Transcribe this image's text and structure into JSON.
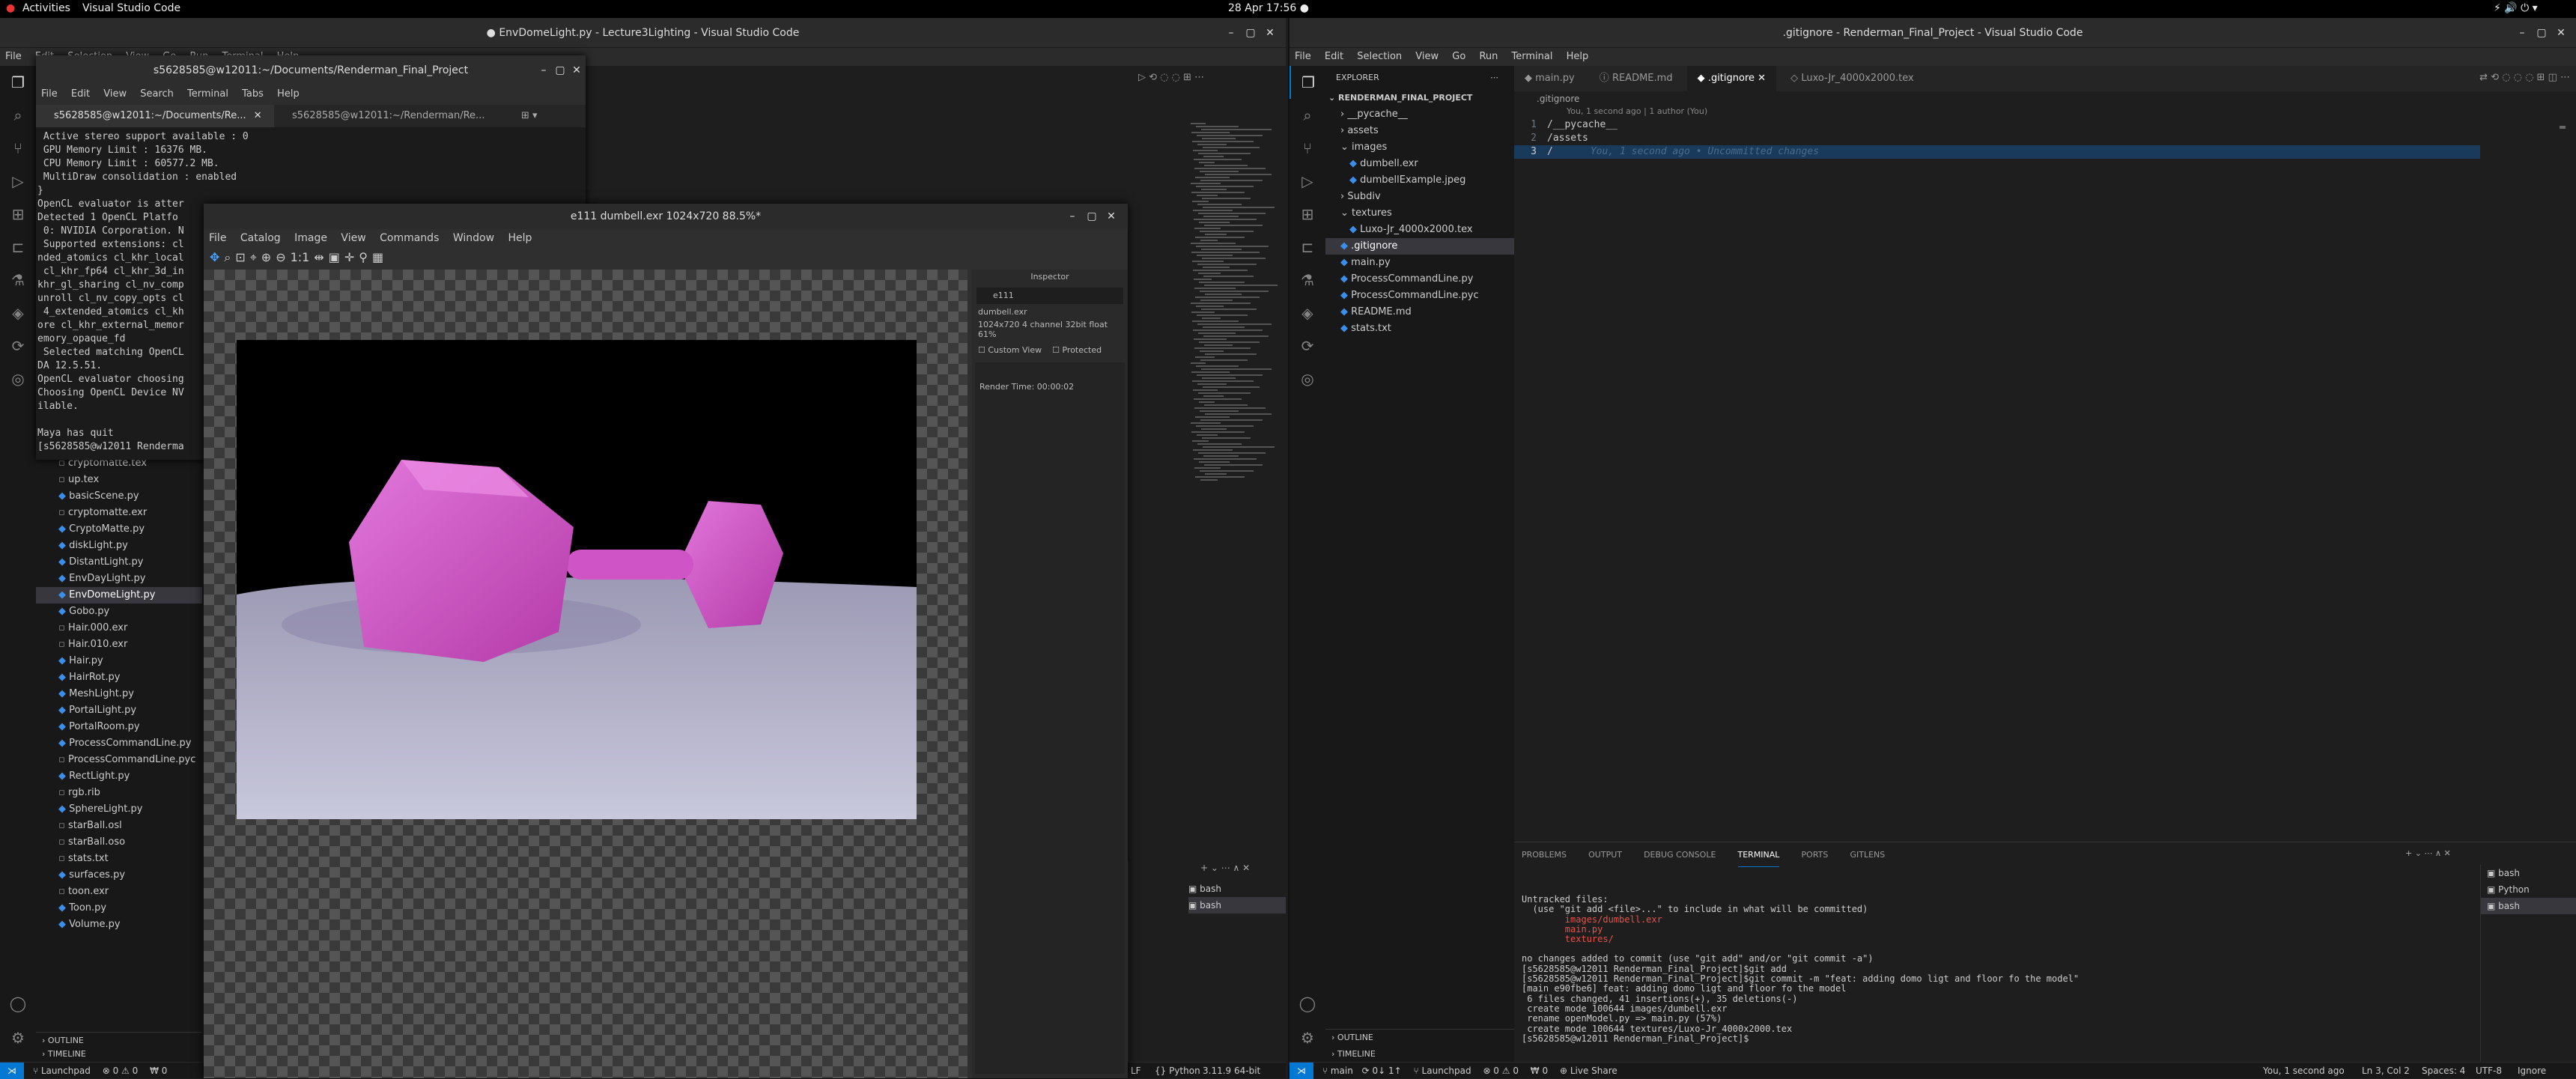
{
  "system": {
    "activities": "Activities",
    "app": "Visual Studio Code",
    "clock": "28 Apr  17:56 ●"
  },
  "left_vscode": {
    "title": "● EnvDomeLight.py - Lecture3Lighting - Visual Studio Code",
    "menu": [
      "File",
      "Edit",
      "Selection",
      "View",
      "Go",
      "Run",
      "Terminal",
      "Help"
    ],
    "files": [
      "cryptomatte.tex",
      "up.tex",
      "basicScene.py",
      "cryptomatte.exr",
      "CryptoMatte.py",
      "diskLight.py",
      "DistantLight.py",
      "EnvDayLight.py",
      "EnvDomeLight.py",
      "Gobo.py",
      "Hair.000.exr",
      "Hair.010.exr",
      "Hair.py",
      "HairRot.py",
      "MeshLight.py",
      "PortalLight.py",
      "PortalRoom.py",
      "ProcessCommandLine.py",
      "ProcessCommandLine.pyc",
      "RectLight.py",
      "rgb.rib",
      "SphereLight.py",
      "starBall.osl",
      "starBall.oso",
      "stats.txt",
      "surfaces.py",
      "toon.exr",
      "Toon.py",
      "Volume.py"
    ],
    "outline": "OUTLINE",
    "timeline": "TIMELINE",
    "term_list": [
      "bash",
      "bash"
    ],
    "status": {
      "branch": "⑂ Launchpad",
      "errors": "⊗ 0 ⚠ 0",
      "w0": "₩ 0",
      "lf": "LF",
      "lang": "{} Python",
      "ver": "3.11.9 64-bit"
    }
  },
  "gnome_terminal": {
    "title": "s5628585@w12011:~/Documents/Renderman_Final_Project",
    "menu": [
      "File",
      "Edit",
      "View",
      "Search",
      "Terminal",
      "Tabs",
      "Help"
    ],
    "tabs": [
      "s5628585@w12011:~/Documents/Re...",
      "s5628585@w12011:~/Renderman/Re..."
    ],
    "lines": [
      " Active stereo support available : 0",
      " GPU Memory Limit : 16376 MB.",
      " CPU Memory Limit : 60577.2 MB.",
      " MultiDraw consolidation : enabled",
      "}",
      "OpenCL evaluator is atter",
      "Detected 1 OpenCL Platfo",
      " 0: NVIDIA Corporation. N",
      " Supported extensions: cl",
      "nded_atomics cl_khr_local",
      " cl_khr_fp64 cl_khr_3d_in",
      "khr_gl_sharing cl_nv_comp",
      "unroll cl_nv_copy_opts cl",
      " 4_extended_atomics cl_kh",
      "ore cl_khr_external_memor",
      "emory_opaque_fd",
      " Selected matching OpenCL",
      "DA 12.5.51.",
      "OpenCL evaluator choosing",
      "Choosing OpenCL Device NV",
      "ilable.",
      "",
      "Maya has quit",
      "[s5628585@w12011 Renderma"
    ]
  },
  "it_viewer": {
    "title": "e111 dumbell.exr 1024x720 88.5%*",
    "menu": [
      "File",
      "Catalog",
      "Image",
      "View",
      "Commands",
      "Window",
      "Help"
    ],
    "inspector": {
      "title": "Inspector",
      "name": "e111",
      "file": "dumbell.exr",
      "info": "1024x720 4 channel 32bit float 61%",
      "custom_view": "Custom View",
      "protected": "Protected",
      "render_time": "Render Time: 00:00:02"
    }
  },
  "right_vscode": {
    "title": ".gitignore - Renderman_Final_Project - Visual Studio Code",
    "menu": [
      "File",
      "Edit",
      "Selection",
      "View",
      "Go",
      "Run",
      "Terminal",
      "Help"
    ],
    "explorer_title": "EXPLORER",
    "project": "RENDERMAN_FINAL_PROJECT",
    "tree": [
      {
        "label": "__pycache__",
        "indent": 1,
        "type": "folder",
        "arrow": "›"
      },
      {
        "label": "assets",
        "indent": 1,
        "type": "folder",
        "arrow": "›"
      },
      {
        "label": "images",
        "indent": 1,
        "type": "folder",
        "arrow": "⌄"
      },
      {
        "label": "dumbell.exr",
        "indent": 2,
        "type": "file"
      },
      {
        "label": "dumbellExample.jpeg",
        "indent": 2,
        "type": "file"
      },
      {
        "label": "Subdiv",
        "indent": 1,
        "type": "folder",
        "arrow": "›"
      },
      {
        "label": "textures",
        "indent": 1,
        "type": "folder",
        "arrow": "⌄"
      },
      {
        "label": "Luxo-Jr_4000x2000.tex",
        "indent": 2,
        "type": "file"
      },
      {
        "label": ".gitignore",
        "indent": 1,
        "type": "file",
        "selected": true
      },
      {
        "label": "main.py",
        "indent": 1,
        "type": "file"
      },
      {
        "label": "ProcessCommandLine.py",
        "indent": 1,
        "type": "file"
      },
      {
        "label": "ProcessCommandLine.pyc",
        "indent": 1,
        "type": "file"
      },
      {
        "label": "README.md",
        "indent": 1,
        "type": "file"
      },
      {
        "label": "stats.txt",
        "indent": 1,
        "type": "file"
      }
    ],
    "tabs": [
      "main.py",
      "README.md",
      ".gitignore",
      "Luxo-Jr_4000x2000.tex"
    ],
    "breadcrumb": ".gitignore",
    "blame": "You, 1 second ago | 1 author (You)",
    "code": [
      "/__pycache__",
      "/assets",
      "/"
    ],
    "inline_blame": "You, 1 second ago • Uncommitted changes",
    "panel_tabs": [
      "PROBLEMS",
      "OUTPUT",
      "DEBUG CONSOLE",
      "TERMINAL",
      "PORTS",
      "GITLENS"
    ],
    "terminal_lines": [
      "Untracked files:",
      "  (use \"git add <file>...\" to include in what will be committed)",
      "        images/dumbell.exr",
      "        main.py",
      "        textures/",
      "",
      "no changes added to commit (use \"git add\" and/or \"git commit -a\")",
      "[s5628585@w12011 Renderman_Final_Project]$git add .",
      "[s5628585@w12011 Renderman_Final_Project]$git commit -m \"feat: adding domo ligt and floor fo the model\"",
      "[main e90fbe6] feat: adding domo ligt and floor fo the model",
      " 6 files changed, 41 insertions(+), 35 deletions(-)",
      " create mode 100644 images/dumbell.exr",
      " rename openModel.py => main.py (57%)",
      " create mode 100644 textures/Luxo-Jr_4000x2000.tex",
      "[s5628585@w12011 Renderman_Final_Project]$"
    ],
    "term_list": [
      "bash",
      "Python",
      "bash"
    ],
    "outline": "OUTLINE",
    "timeline": "TIMELINE",
    "status": {
      "branch": "⑂ main",
      "sync": "⟳ 0↓ 1↑",
      "launch": "⑂ Launchpad",
      "errors": "⊗ 0 ⚠ 0",
      "w0": "₩ 0",
      "live": "⊕ Live Share",
      "blame": "You, 1 second ago",
      "pos": "Ln 3, Col 2",
      "spaces": "Spaces: 4",
      "enc": "UTF-8",
      "ignore": "Ignore"
    }
  },
  "colors": {
    "accent": "#0078d4",
    "dumbbell": "#d65ad0",
    "floor": "#b8b8d0"
  }
}
